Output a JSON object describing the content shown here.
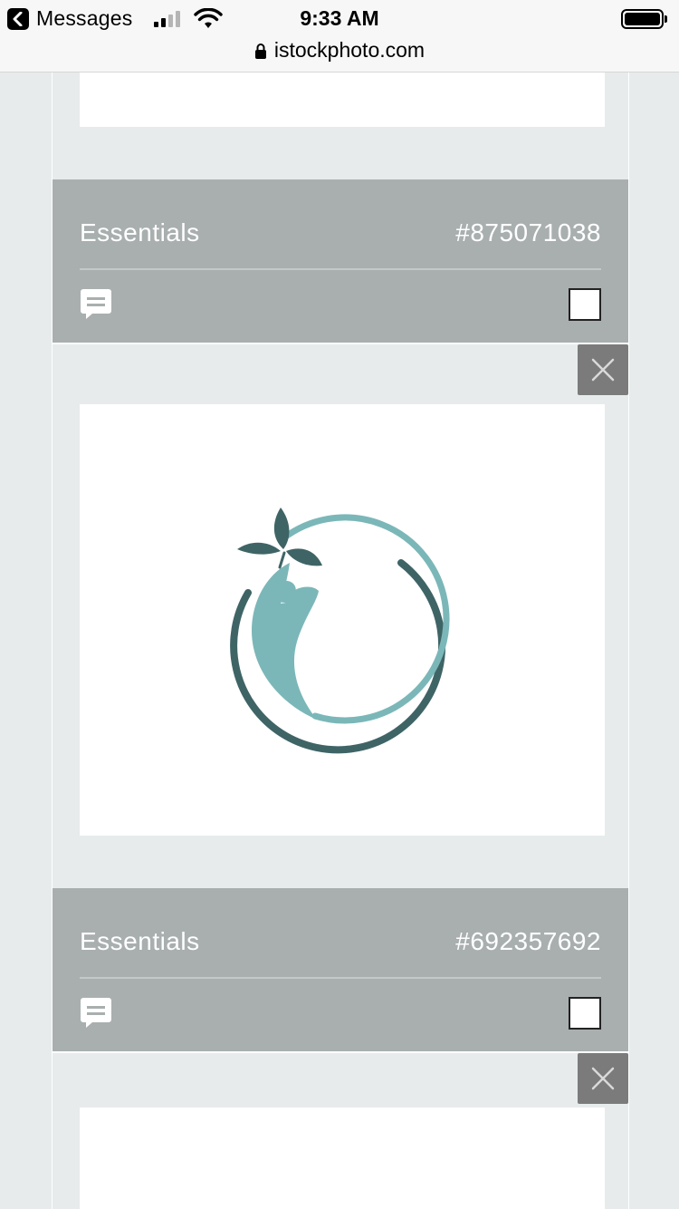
{
  "status_bar": {
    "back_label": "Messages",
    "time": "9:33 AM",
    "signal_bars_active": 2,
    "signal_bars_total": 4
  },
  "url_bar": {
    "domain": "istockphoto.com"
  },
  "cards": [
    {
      "label": "Essentials",
      "id": "#875071038",
      "checked": false
    },
    {
      "label": "Essentials",
      "id": "#692357692",
      "checked": false
    }
  ],
  "icons": {
    "back": "chevron-left-icon",
    "lock": "lock-icon",
    "comment": "comment-icon",
    "close": "close-icon"
  },
  "colors": {
    "page_bg": "#e7ebeb",
    "info_bar": "#a9afaf",
    "close_bg": "#7b7b7b",
    "logo_teal": "#7bb7b8",
    "logo_dark": "#3f6466"
  }
}
